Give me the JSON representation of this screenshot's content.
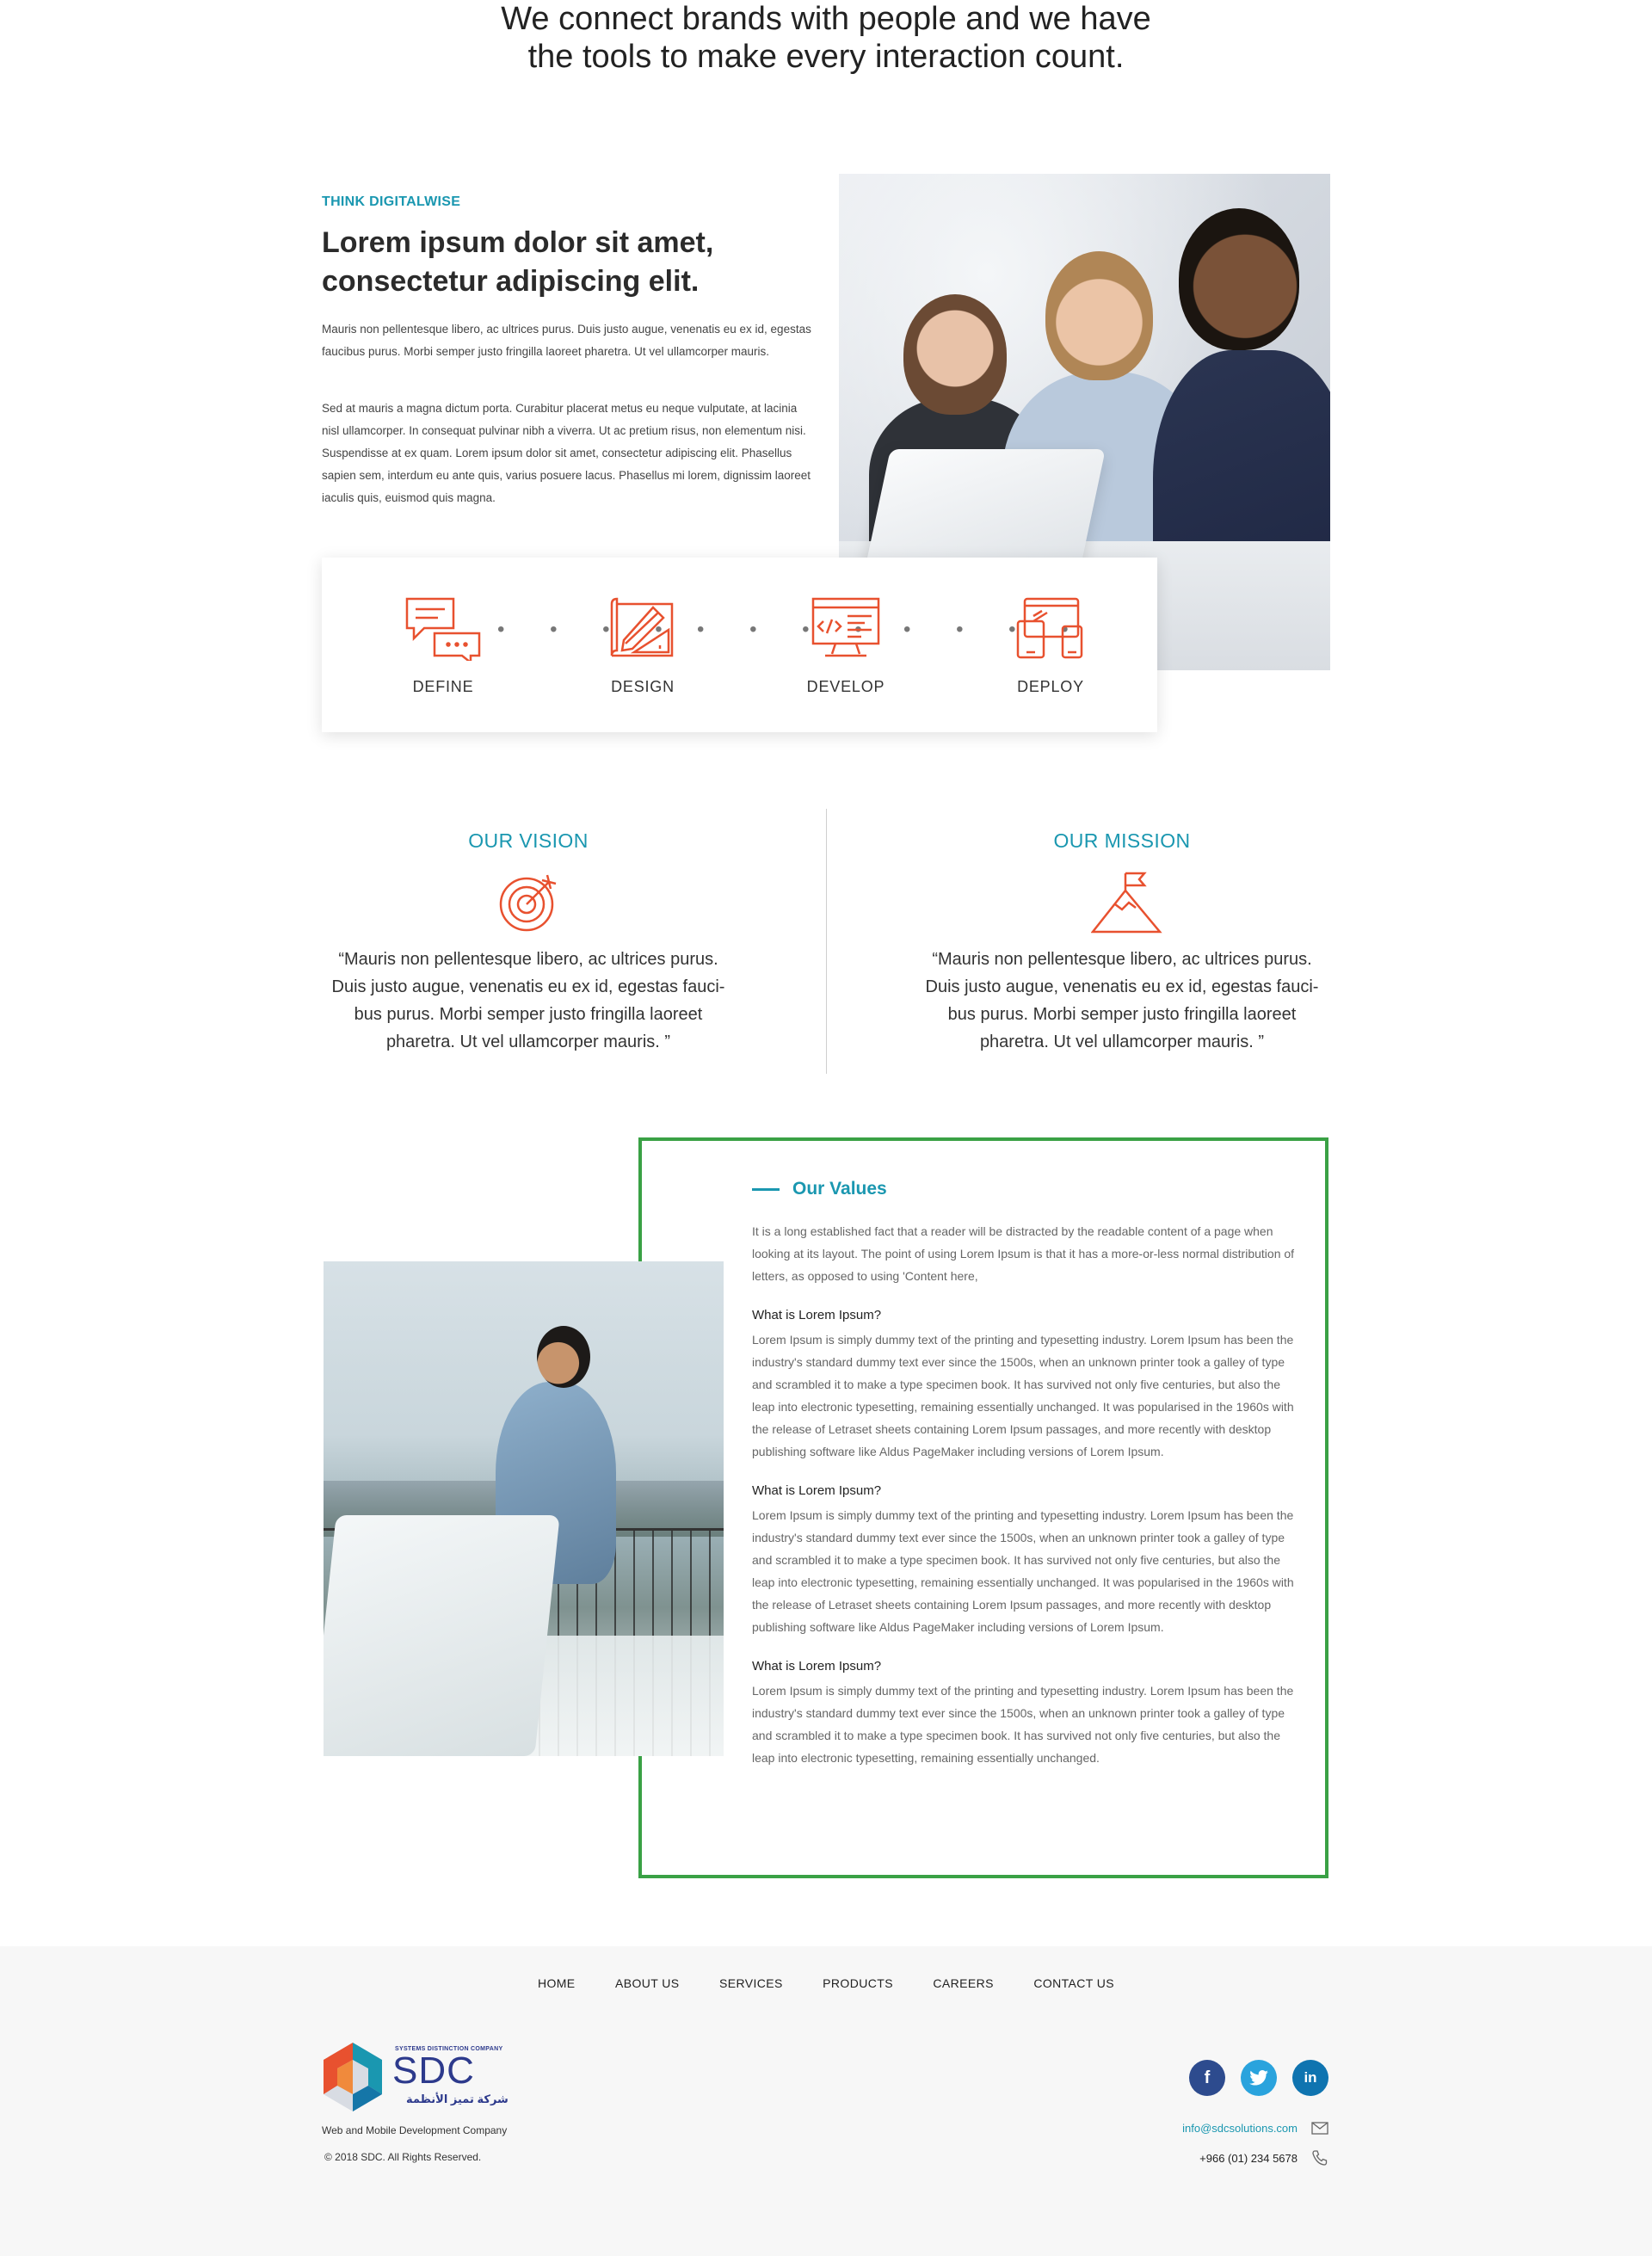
{
  "hero": {
    "title": "We connect brands with people and we have the tools to make every interaction count."
  },
  "about": {
    "eyebrow": "THINK DIGITALWISE",
    "heading": "Lorem ipsum dolor sit amet, consectetur adipiscing elit.",
    "paragraph1": "Mauris non pellentesque libero, ac ultrices purus. Duis justo augue, venenatis eu ex id, egestas faucibus purus. Morbi semper justo fringilla laoreet pharetra. Ut vel ullamcorper mauris.",
    "paragraph2": "Sed at mauris a magna dictum porta. Curabitur placerat metus eu neque vulputate, at lacinia nisl ullamcorper. In consequat pulvinar nibh a viverra. Ut ac pretium risus, non elementum nisi. Suspendisse at ex quam. Lorem ipsum dolor sit amet, consectetur adipiscing elit. Phasellus sapien sem, interdum eu ante quis, varius posuere lacus. Phasellus mi lorem, dignissim laoreet iaculis quis, euismod quis magna."
  },
  "process": {
    "steps": [
      {
        "label": "DEFINE",
        "icon": "chat-bubbles-icon"
      },
      {
        "label": "DESIGN",
        "icon": "drafting-tools-icon"
      },
      {
        "label": "DEVELOP",
        "icon": "code-monitor-icon"
      },
      {
        "label": "DEPLOY",
        "icon": "multi-device-icon"
      }
    ],
    "accent_color": "#e8512f"
  },
  "vision": {
    "title": "OUR VISION",
    "icon": "target-icon",
    "quote": "“Mauris non pellentesque libero, ac ultrices purus. Duis justo augue, venenatis eu ex id, egestas fauci-bus purus. Morbi semper justo fringilla laoreet pharetra. Ut vel ullamcorper mauris. ”"
  },
  "mission": {
    "title": "OUR MISSION",
    "icon": "mountain-flag-icon",
    "quote": "“Mauris non pellentesque libero, ac ultrices purus. Duis justo augue, venenatis eu ex id, egestas fauci-bus purus. Morbi semper justo fringilla laoreet pharetra. Ut vel ullamcorper mauris. ”"
  },
  "values": {
    "title": "Our Values",
    "intro": "It is a long established fact that a reader will be distracted by the readable content of a page when looking at its layout. The point of using Lorem Ipsum is that it has a more-or-less normal distribution of letters, as opposed to using 'Content here,",
    "items": [
      {
        "title": "What is Lorem Ipsum?",
        "body": "Lorem Ipsum is simply dummy text of the printing and typesetting industry. Lorem Ipsum has been the industry's standard dummy text ever since the 1500s, when an unknown printer took a galley of type and scrambled it to make a type specimen book. It has survived not only five centuries, but also the leap into electronic typesetting, remaining essentially unchanged. It was popularised in the 1960s with the release of Letraset sheets containing Lorem Ipsum passages, and more recently with desktop publishing software like Aldus PageMaker including versions of Lorem Ipsum."
      },
      {
        "title": "What is Lorem Ipsum?",
        "body": "Lorem Ipsum is simply dummy text of the printing and typesetting industry. Lorem Ipsum has been the industry's standard dummy text ever since the 1500s, when an unknown printer took a galley of type and scrambled it to make a type specimen book. It has survived not only five centuries, but also the leap into electronic typesetting, remaining essentially unchanged. It was popularised in the 1960s with the release of Letraset sheets containing Lorem Ipsum passages, and more recently with desktop publishing software like Aldus PageMaker including versions of Lorem Ipsum."
      },
      {
        "title": "What is Lorem Ipsum?",
        "body": "Lorem Ipsum is simply dummy text of the printing and typesetting industry. Lorem Ipsum has been the industry's standard dummy text ever since the 1500s, when an unknown printer took a galley of type and scrambled it to make a type specimen book. It has survived not only five centuries, but also the leap into electronic typesetting, remaining essentially unchanged."
      }
    ],
    "border_color": "#3aa145"
  },
  "footer": {
    "nav": [
      "HOME",
      "ABOUT US",
      "SERVICES",
      "PRODUCTS",
      "CAREERS",
      "CONTACT US"
    ],
    "logo": {
      "tagline": "SYSTEMS DISTINCTION COMPANY",
      "brand": "SDC",
      "arabic": "شركة تميز الأنظمة"
    },
    "company": "Web and Mobile Development Company",
    "copyright": "© 2018 SDC. All Rights Reserved.",
    "social": [
      {
        "name": "facebook",
        "glyph": "f"
      },
      {
        "name": "twitter",
        "glyph": "t"
      },
      {
        "name": "linkedin",
        "glyph": "in"
      }
    ],
    "email": "info@sdcsolutions.com",
    "phone": "+966 (01) 234 5678"
  },
  "colors": {
    "accent_teal": "#1a97b0",
    "accent_orange": "#e8512f",
    "values_green": "#3aa145",
    "brand_navy": "#2d3a8c"
  }
}
